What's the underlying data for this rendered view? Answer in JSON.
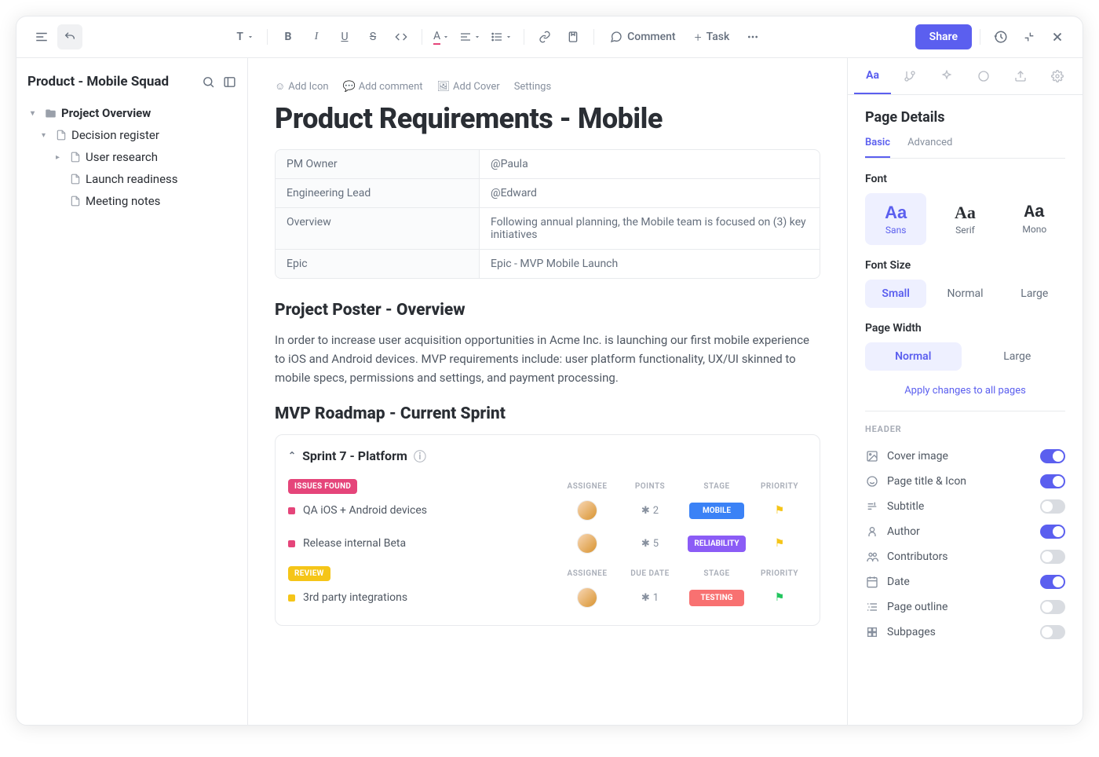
{
  "toolbar": {
    "comment": "Comment",
    "task": "Task",
    "share": "Share"
  },
  "sidebar": {
    "title": "Product - Mobile Squad",
    "items": [
      {
        "label": "Project Overview",
        "indent": 0,
        "bold": true,
        "icon": "folder",
        "caret": "▾"
      },
      {
        "label": "Decision register",
        "indent": 1,
        "icon": "doc",
        "caret": "▾"
      },
      {
        "label": "User research",
        "indent": 2,
        "icon": "doc",
        "caret": "▸"
      },
      {
        "label": "Launch readiness",
        "indent": 2,
        "icon": "doc",
        "caret": ""
      },
      {
        "label": "Meeting notes",
        "indent": 2,
        "icon": "doc",
        "caret": ""
      }
    ]
  },
  "pageActions": {
    "addIcon": "Add Icon",
    "addComment": "Add comment",
    "addCover": "Add Cover",
    "settings": "Settings"
  },
  "page": {
    "title": "Product Requirements - Mobile",
    "meta": [
      {
        "k": "PM Owner",
        "v": "@Paula"
      },
      {
        "k": "Engineering Lead",
        "v": "@Edward"
      },
      {
        "k": "Overview",
        "v": "Following annual planning, the Mobile team is focused on (3) key initiatives"
      },
      {
        "k": "Epic",
        "v": "Epic - MVP Mobile Launch"
      }
    ],
    "section1Title": "Project Poster - Overview",
    "section1Body": "In order to increase user acquisition opportunities in Acme Inc. is launching our first mobile experience to iOS and Android devices. MVP requirements include: user platform functionality, UX/UI skinned to mobile specs, permissions and settings, and payment processing.",
    "section2Title": "MVP Roadmap - Current Sprint",
    "sprint": {
      "name": "Sprint  7 - Platform",
      "groups": [
        {
          "label": "ISSUES FOUND",
          "class": "group-issues",
          "cols": [
            "ASSIGNEE",
            "POINTS",
            "STAGE",
            "PRIORITY"
          ],
          "tasks": [
            {
              "name": "QA iOS + Android devices",
              "sq": "sq-pink",
              "points": "2",
              "stage": "MOBILE",
              "stageClass": "stage-mobile",
              "flagClass": "flag-y"
            },
            {
              "name": "Release internal Beta",
              "sq": "sq-pink",
              "points": "5",
              "stage": "RELIABILITY",
              "stageClass": "stage-reliability",
              "flagClass": "flag-y"
            }
          ]
        },
        {
          "label": "REVIEW",
          "class": "group-review",
          "cols": [
            "ASSIGNEE",
            "DUE DATE",
            "STAGE",
            "PRIORITY"
          ],
          "tasks": [
            {
              "name": "3rd party integrations",
              "sq": "sq-yellow",
              "points": "1",
              "stage": "TESTING",
              "stageClass": "stage-testing",
              "flagClass": "flag-g"
            }
          ]
        }
      ]
    }
  },
  "right": {
    "title": "Page Details",
    "subtabs": [
      "Basic",
      "Advanced"
    ],
    "fontLabel": "Font",
    "fonts": [
      {
        "big": "Aa",
        "lbl": "Sans",
        "active": true,
        "family": "sans-serif"
      },
      {
        "big": "Aa",
        "lbl": "Serif",
        "family": "serif"
      },
      {
        "big": "Aa",
        "lbl": "Mono",
        "family": "monospace"
      }
    ],
    "fontSizeLabel": "Font Size",
    "fontSizes": [
      "Small",
      "Normal",
      "Large"
    ],
    "fontSizeActive": 0,
    "pageWidthLabel": "Page Width",
    "pageWidths": [
      "Normal",
      "Large"
    ],
    "pageWidthActive": 0,
    "applyLink": "Apply changes to all pages",
    "headerLabel": "HEADER",
    "toggles": [
      {
        "label": "Cover image",
        "icon": "image",
        "on": true
      },
      {
        "label": "Page title & Icon",
        "icon": "emoji",
        "on": true
      },
      {
        "label": "Subtitle",
        "icon": "subtitle",
        "on": false
      },
      {
        "label": "Author",
        "icon": "author",
        "on": true
      },
      {
        "label": "Contributors",
        "icon": "contributors",
        "on": false
      },
      {
        "label": "Date",
        "icon": "date",
        "on": true
      },
      {
        "label": "Page outline",
        "icon": "outline",
        "on": false
      },
      {
        "label": "Subpages",
        "icon": "subpages",
        "on": false
      }
    ]
  }
}
